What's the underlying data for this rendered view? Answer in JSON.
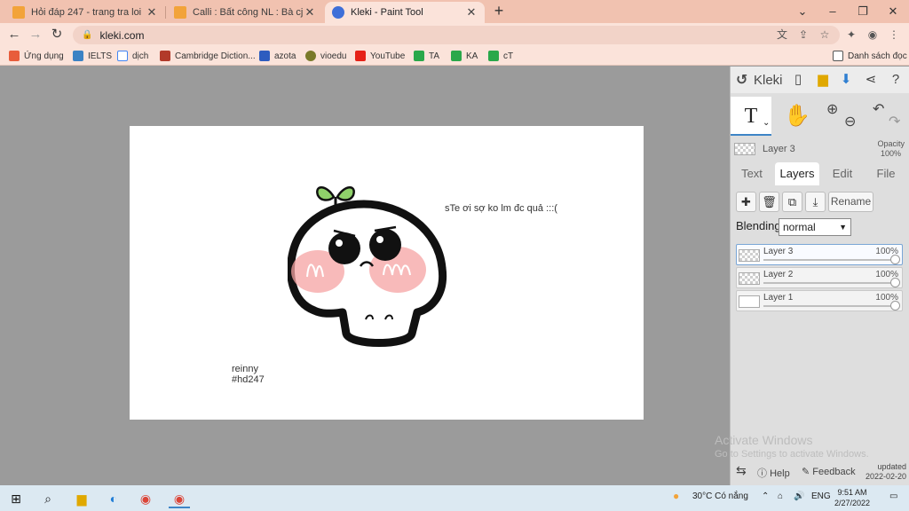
{
  "browser": {
    "tabs": [
      {
        "title": "Hỏi đáp 247 - trang tra loi",
        "active": false
      },
      {
        "title": "Calli : Bất công NL : Bà cj t ngủ N",
        "active": false
      },
      {
        "title": "Kleki - Paint Tool",
        "active": true
      }
    ],
    "url": "kleki.com",
    "bookmarks": [
      "Ứng dụng",
      "IELTS",
      "dịch",
      "Cambridge Diction...",
      "azota",
      "vioedu",
      "YouTube",
      "TA",
      "KA",
      "cT"
    ],
    "reading_list": "Danh sách đọc"
  },
  "canvas": {
    "caption_top": "sTe ơi sợ ko lm đc quả :::(",
    "caption_name": "reinny",
    "caption_tag": "#hd247"
  },
  "panel": {
    "brand": "Kleki",
    "current_layer": "Layer 3",
    "opacity_label": "Opacity",
    "opacity_value": "100%",
    "tabs": [
      "Text",
      "Layers",
      "Edit",
      "File"
    ],
    "selected_tab": "Layers",
    "rename_label": "Rename",
    "blending_label": "Blending",
    "blending_value": "normal",
    "layers": [
      {
        "name": "Layer 3",
        "opacity": "100%",
        "selected": true
      },
      {
        "name": "Layer 2",
        "opacity": "100%",
        "selected": false
      },
      {
        "name": "Layer 1",
        "opacity": "100%",
        "selected": false
      }
    ],
    "watermark_title": "Activate Windows",
    "watermark_sub": "Go to Settings to activate Windows.",
    "help_label": "Help",
    "feedback_label": "Feedback",
    "updated_label": "updated",
    "updated_date": "2022-02-20"
  },
  "taskbar": {
    "weather": "30°C Có nắng",
    "language": "ENG",
    "time": "9:51 AM",
    "date": "2/27/2022"
  },
  "colors": {
    "tab_strip": "#f1c2b0",
    "toolbar": "#fbe3da",
    "workspace": "#9b9b9b",
    "accent": "#3e85c7"
  }
}
